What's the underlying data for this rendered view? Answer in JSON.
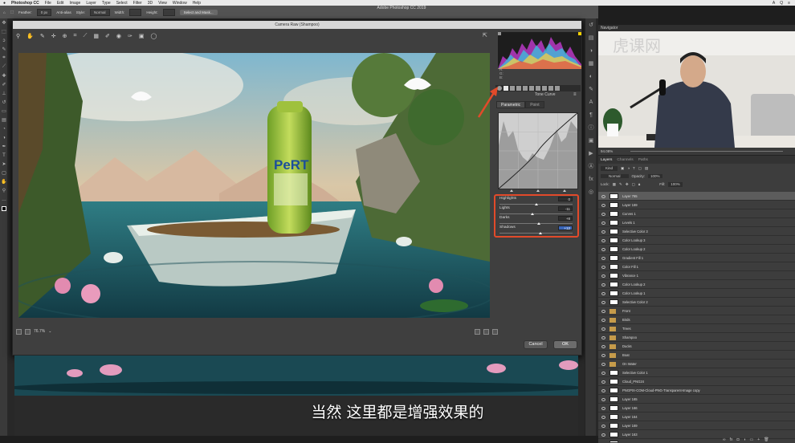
{
  "menubar": {
    "app": "Photoshop CC",
    "items": [
      "File",
      "Edit",
      "Image",
      "Layer",
      "Type",
      "Select",
      "Filter",
      "3D",
      "View",
      "Window",
      "Help"
    ],
    "right": [
      "A",
      "Q",
      "≡"
    ]
  },
  "options_bar": {
    "feather_label": "Feather:",
    "feather_value": "0 px",
    "antialias": "Anti-alias",
    "style_label": "Style:",
    "style_value": "Normal",
    "width_label": "Width:",
    "height_label": "Height:",
    "select_mask": "Select and Mask..."
  },
  "ps_title": "Adobe Photoshop CC 2019",
  "dialog": {
    "title": "Camera Raw (Shampoo)",
    "zoom": "76.7%",
    "cancel": "Cancel",
    "ok": "OK",
    "rgb_readout": [
      "R:",
      "G:",
      "B:"
    ],
    "panel_title": "Tone Curve",
    "tabs": [
      "Parametric",
      "Point"
    ],
    "sliders": [
      {
        "label": "Highlights",
        "value": "0",
        "pos": 0.5,
        "selected": false
      },
      {
        "label": "Lights",
        "value": "-11",
        "pos": 0.45,
        "selected": false
      },
      {
        "label": "Darks",
        "value": "+8",
        "pos": 0.54,
        "selected": false
      },
      {
        "label": "Shadows",
        "value": "+12",
        "pos": 0.56,
        "selected": true
      }
    ]
  },
  "subtitle": "当然 这里都是增强效果的",
  "navigator": {
    "title": "Navigator",
    "zoom": "94.08%"
  },
  "layers_panel": {
    "tabs": [
      "Layers",
      "Channels",
      "Paths"
    ],
    "kind": "Kind",
    "blend_mode": "Normal",
    "opacity_label": "Opacity:",
    "opacity": "100%",
    "lock_label": "Lock:",
    "fill_label": "Fill:",
    "fill": "100%",
    "layers": [
      {
        "name": "Layer 765",
        "folder": false,
        "selected": true
      },
      {
        "name": "Layer 169",
        "folder": false,
        "selected": false
      },
      {
        "name": "Curves 1",
        "folder": false,
        "selected": false
      },
      {
        "name": "Levels 1",
        "folder": false,
        "selected": false
      },
      {
        "name": "Selective Color 3",
        "folder": false,
        "selected": false
      },
      {
        "name": "Color Lookup 3",
        "folder": false,
        "selected": false
      },
      {
        "name": "Color Lookup 2",
        "folder": false,
        "selected": false
      },
      {
        "name": "Gradient Fill 1",
        "folder": false,
        "selected": false
      },
      {
        "name": "Color Fill 1",
        "folder": false,
        "selected": false
      },
      {
        "name": "Vibrance 1",
        "folder": false,
        "selected": false
      },
      {
        "name": "Color Lookup 2",
        "folder": false,
        "selected": false
      },
      {
        "name": "Color Lookup 1",
        "folder": false,
        "selected": false
      },
      {
        "name": "Selective Color 2",
        "folder": false,
        "selected": false
      },
      {
        "name": "Front",
        "folder": true,
        "selected": false
      },
      {
        "name": "Birds",
        "folder": true,
        "selected": false
      },
      {
        "name": "Trees",
        "folder": true,
        "selected": false
      },
      {
        "name": "Shampoo",
        "folder": true,
        "selected": false
      },
      {
        "name": "Ducks",
        "folder": true,
        "selected": false
      },
      {
        "name": "Boat",
        "folder": true,
        "selected": false
      },
      {
        "name": "On Water",
        "folder": true,
        "selected": false
      },
      {
        "name": "Selective Color 1",
        "folder": false,
        "selected": false
      },
      {
        "name": "Cloud_PNG24",
        "folder": false,
        "selected": false
      },
      {
        "name": "PNGPIX-COM-Cloud-PNG-Transparent-Image copy",
        "folder": false,
        "selected": false
      },
      {
        "name": "Layer 165",
        "folder": false,
        "selected": false
      },
      {
        "name": "Layer 166",
        "folder": false,
        "selected": false
      },
      {
        "name": "Layer 164",
        "folder": false,
        "selected": false
      },
      {
        "name": "Layer 169",
        "folder": false,
        "selected": false
      },
      {
        "name": "Layer 163",
        "folder": false,
        "selected": false
      },
      {
        "name": "Layer 168",
        "folder": false,
        "selected": false
      }
    ]
  }
}
